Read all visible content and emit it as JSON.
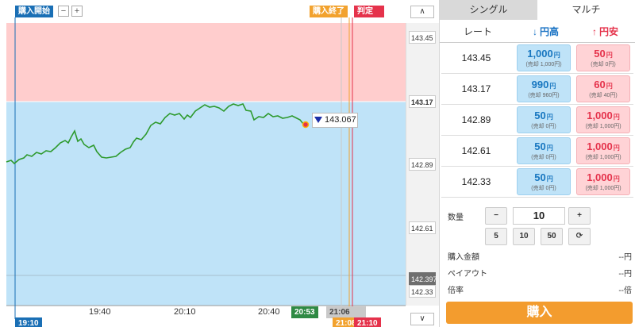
{
  "chart": {
    "start_tag": "購入開始",
    "end_tag": "購入終了",
    "judge_tag": "判定",
    "zoom_minus": "−",
    "zoom_plus": "+",
    "up_arrow": "∧",
    "down_arrow": "∨",
    "times": [
      "19:40",
      "20:10",
      "20:40"
    ],
    "current_time": "20:53",
    "end_time_gray": "21:06",
    "start_time": "19:10",
    "end_time": "21:08",
    "judge_time": "21:10",
    "price_labels": [
      "143.45",
      "143.17",
      "142.89",
      "142.61",
      "142.397",
      "142.33"
    ],
    "current_price": "143.067",
    "colors": {
      "line": "#2e9a2e",
      "upper_zone": "#ffcdcd",
      "lower_zone": "#bfe3f8"
    }
  },
  "panel": {
    "tab_single": "シングル",
    "tab_multi": "マルチ",
    "header_rate": "レート",
    "header_up": "円高",
    "header_down": "円安",
    "arrow_up_icon": "arrow-down-icon",
    "rows": [
      {
        "rate": "143.45",
        "up_price": "1,000",
        "up_sub": "(売却 1,000円)",
        "down_price": "50",
        "down_sub": "(売却 0円)"
      },
      {
        "rate": "143.17",
        "up_price": "990",
        "up_sub": "(売却 960円)",
        "down_price": "60",
        "down_sub": "(売却 40円)"
      },
      {
        "rate": "142.89",
        "up_price": "50",
        "up_sub": "(売却 0円)",
        "down_price": "1,000",
        "down_sub": "(売却 1,000円)"
      },
      {
        "rate": "142.61",
        "up_price": "50",
        "up_sub": "(売却 0円)",
        "down_price": "1,000",
        "down_sub": "(売却 1,000円)"
      },
      {
        "rate": "142.33",
        "up_price": "50",
        "up_sub": "(売却 0円)",
        "down_price": "1,000",
        "down_sub": "(売却 1,000円)"
      }
    ],
    "unit": "円",
    "qty_label": "数量",
    "qty_value": "10",
    "qty_minus": "−",
    "qty_plus": "+",
    "presets": [
      "5",
      "10",
      "50"
    ],
    "reset_icon": "⟳",
    "purchase_amount_label": "購入金額",
    "purchase_amount_value": "--円",
    "payout_label": "ペイアウト",
    "payout_value": "--円",
    "multiplier_label": "倍率",
    "multiplier_value": "--倍",
    "buy_label": "購入"
  }
}
